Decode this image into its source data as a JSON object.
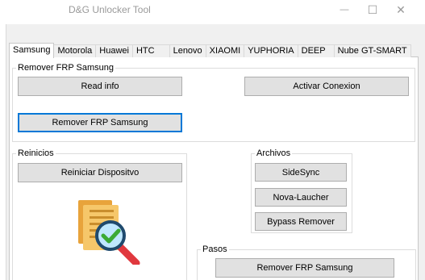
{
  "window": {
    "title": "D&G Unlocker Tool"
  },
  "titlebar": {
    "minimize_glyph": "—",
    "maximize_glyph": "☐",
    "close_glyph": "✕"
  },
  "tabs": [
    {
      "label": "Samsung",
      "active": true
    },
    {
      "label": "Motorola"
    },
    {
      "label": "Huawei"
    },
    {
      "label": "HTC"
    },
    {
      "label": "Lenovo"
    },
    {
      "label": "XIAOMI"
    },
    {
      "label": "YUPHORIA"
    },
    {
      "label": "DEEP"
    },
    {
      "label": "Nube GT-SMART"
    }
  ],
  "frp_group": {
    "title": "Remover FRP Samsung",
    "read_info": "Read info",
    "activar_conexion": "Activar Conexion",
    "remover_frp": "Remover FRP Samsung"
  },
  "reinicios_group": {
    "title": "Reinicios",
    "reiniciar": "Reiniciar Dispositvo",
    "illustration_icon": "document-search-check-icon"
  },
  "archivos_group": {
    "title": "Archivos",
    "sidesync": "SideSync",
    "nova": "Nova-Laucher",
    "bypass": "Bypass Remover"
  },
  "pasos_group": {
    "title": "Pasos",
    "remover_frp": "Remover FRP Samsung"
  },
  "colors": {
    "focus": "#0078d7",
    "button_face": "#e1e1e1",
    "check_green": "#3aaa35",
    "magnifier_red": "#e0383e"
  }
}
